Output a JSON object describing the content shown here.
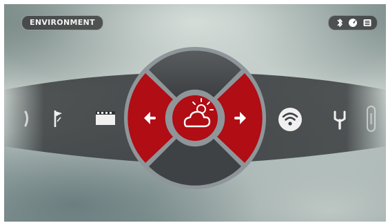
{
  "header": {
    "mode_label": "ENVIRONMENT"
  },
  "status_icons": [
    "bluetooth-icon",
    "compass-icon",
    "battery-icon"
  ],
  "carousel": {
    "left_items": [
      "partial-icon",
      "flag-icon",
      "film-icon"
    ],
    "center_item": "weather-icon",
    "right_items": [
      "wifi-icon",
      "wrench-icon",
      "partial-icon"
    ],
    "nav_buttons": [
      "previous-arrow",
      "next-arrow"
    ]
  },
  "colors": {
    "accent": "#b00d14",
    "panel": "#4a4d4f",
    "ring": "#8e969a",
    "badge": "#3a3c3c"
  }
}
